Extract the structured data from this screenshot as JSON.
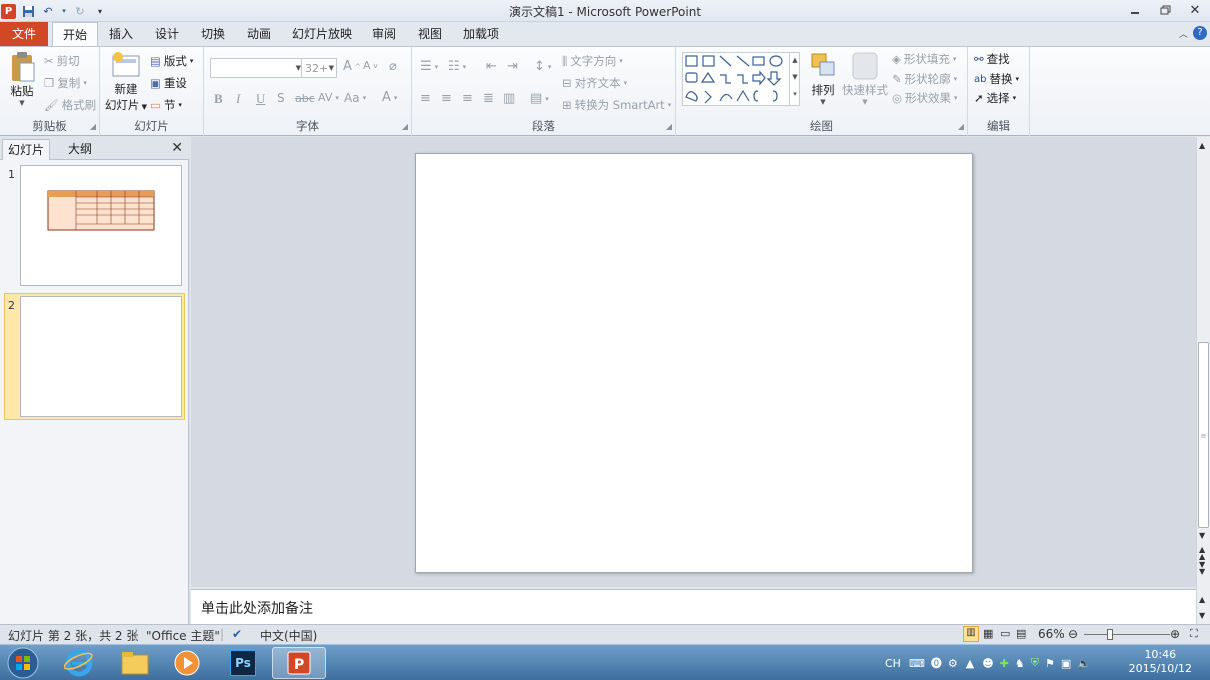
{
  "window": {
    "title": "演示文稿1  -  Microsoft PowerPoint",
    "app_logo": "P",
    "controls": [
      "minimize-icon",
      "restore-icon",
      "close-icon"
    ]
  },
  "ribbon_tabs": [
    "文件",
    "开始",
    "插入",
    "设计",
    "切换",
    "动画",
    "幻灯片放映",
    "审阅",
    "视图",
    "加载项"
  ],
  "ribbon": {
    "clipboard": {
      "paste": "粘贴",
      "cut": "剪切",
      "copy": "复制",
      "format_painter": "格式刷",
      "label": "剪贴板"
    },
    "slides": {
      "new_slide_1": "新建",
      "new_slide_2": "幻灯片",
      "layout": "版式",
      "reset": "重设",
      "section": "节",
      "label": "幻灯片"
    },
    "font": {
      "font_name": "",
      "font_size": "32+",
      "label": "字体",
      "bold": "B",
      "italic": "I",
      "underline": "U",
      "shadow": "S",
      "strike": "abc",
      "spacing": "AV",
      "case": "Aa",
      "color": "A"
    },
    "paragraph": {
      "text_direction": "文字方向",
      "align_text": "对齐文本",
      "smartart": "转换为 SmartArt",
      "label": "段落"
    },
    "drawing": {
      "arrange": "排列",
      "quick_styles": "快速样式",
      "shape_fill": "形状填充",
      "shape_outline": "形状轮廓",
      "shape_effects": "形状效果",
      "label": "绘图"
    },
    "editing": {
      "find": "查找",
      "replace": "替换",
      "select": "选择",
      "label": "编辑"
    }
  },
  "panel": {
    "tabs": [
      "幻灯片",
      "大纲"
    ],
    "slides": [
      {
        "number": "1",
        "has_table": true
      },
      {
        "number": "2",
        "has_table": false
      }
    ]
  },
  "notes": {
    "placeholder": "单击此处添加备注"
  },
  "status": {
    "slide_info": "幻灯片 第 2 张，共 2 张",
    "theme": "\"Office 主题\"",
    "language": "中文(中国)",
    "zoom": "66%"
  },
  "taskbar": {
    "apps": [
      "windows-start-icon",
      "internet-explorer-icon",
      "file-explorer-icon",
      "media-player-icon",
      "photoshop-icon",
      "powerpoint-icon"
    ],
    "ps_label": "Ps",
    "input": "CH",
    "time": "10:46",
    "date": "2015/10/12"
  },
  "colors": {
    "file_tab": "#d24726",
    "selection": "#fde8a8",
    "taskbar": "#3d6e9e"
  }
}
